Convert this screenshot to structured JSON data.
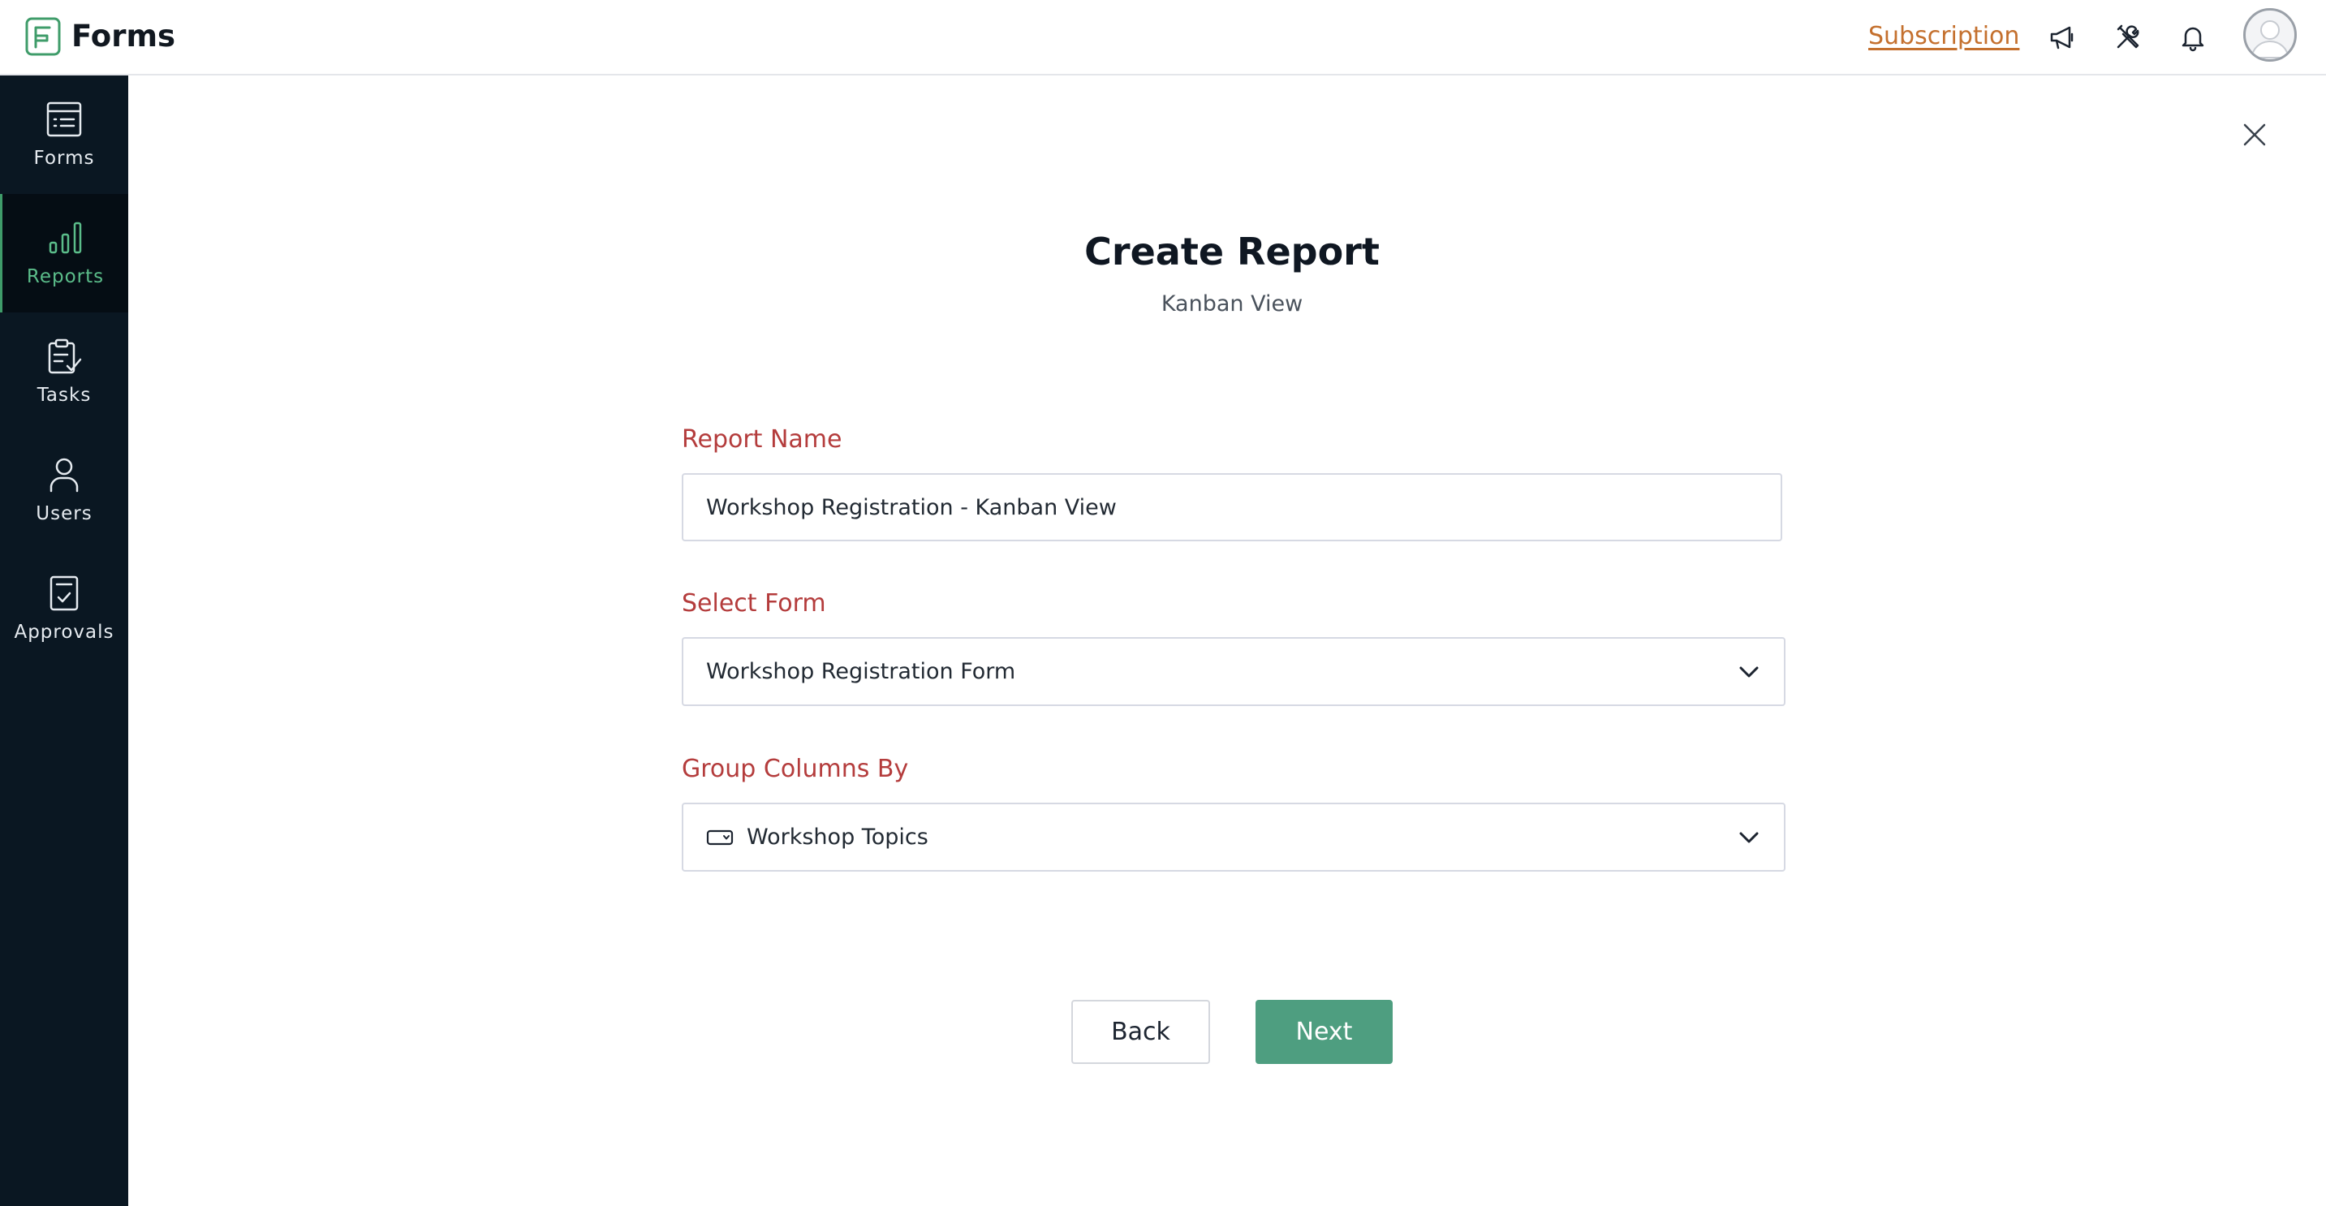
{
  "app": {
    "title": "Forms"
  },
  "header": {
    "subscription_label": "Subscription",
    "icons": [
      "megaphone-icon",
      "tools-icon",
      "bell-icon",
      "avatar"
    ]
  },
  "sidebar": {
    "items": [
      {
        "label": "Forms",
        "icon": "forms-icon",
        "active": false
      },
      {
        "label": "Reports",
        "icon": "reports-icon",
        "active": true
      },
      {
        "label": "Tasks",
        "icon": "tasks-icon",
        "active": false
      },
      {
        "label": "Users",
        "icon": "users-icon",
        "active": false
      },
      {
        "label": "Approvals",
        "icon": "approvals-icon",
        "active": false
      }
    ]
  },
  "dialog": {
    "title": "Create Report",
    "subtitle": "Kanban View",
    "report_name": {
      "label": "Report Name",
      "value": "Workshop Registration - Kanban View"
    },
    "select_form": {
      "label": "Select Form",
      "value": "Workshop Registration Form"
    },
    "group_columns": {
      "label": "Group Columns By",
      "value": "Workshop Topics",
      "field_icon": "dropdown-field-icon"
    },
    "back_label": "Back",
    "next_label": "Next"
  },
  "colors": {
    "sidebar_bg": "#0a1722",
    "active_accent": "#5bbd8a",
    "label_red": "#b43c3c",
    "next_button": "#4e9e80",
    "subscription": "#c4702e"
  }
}
